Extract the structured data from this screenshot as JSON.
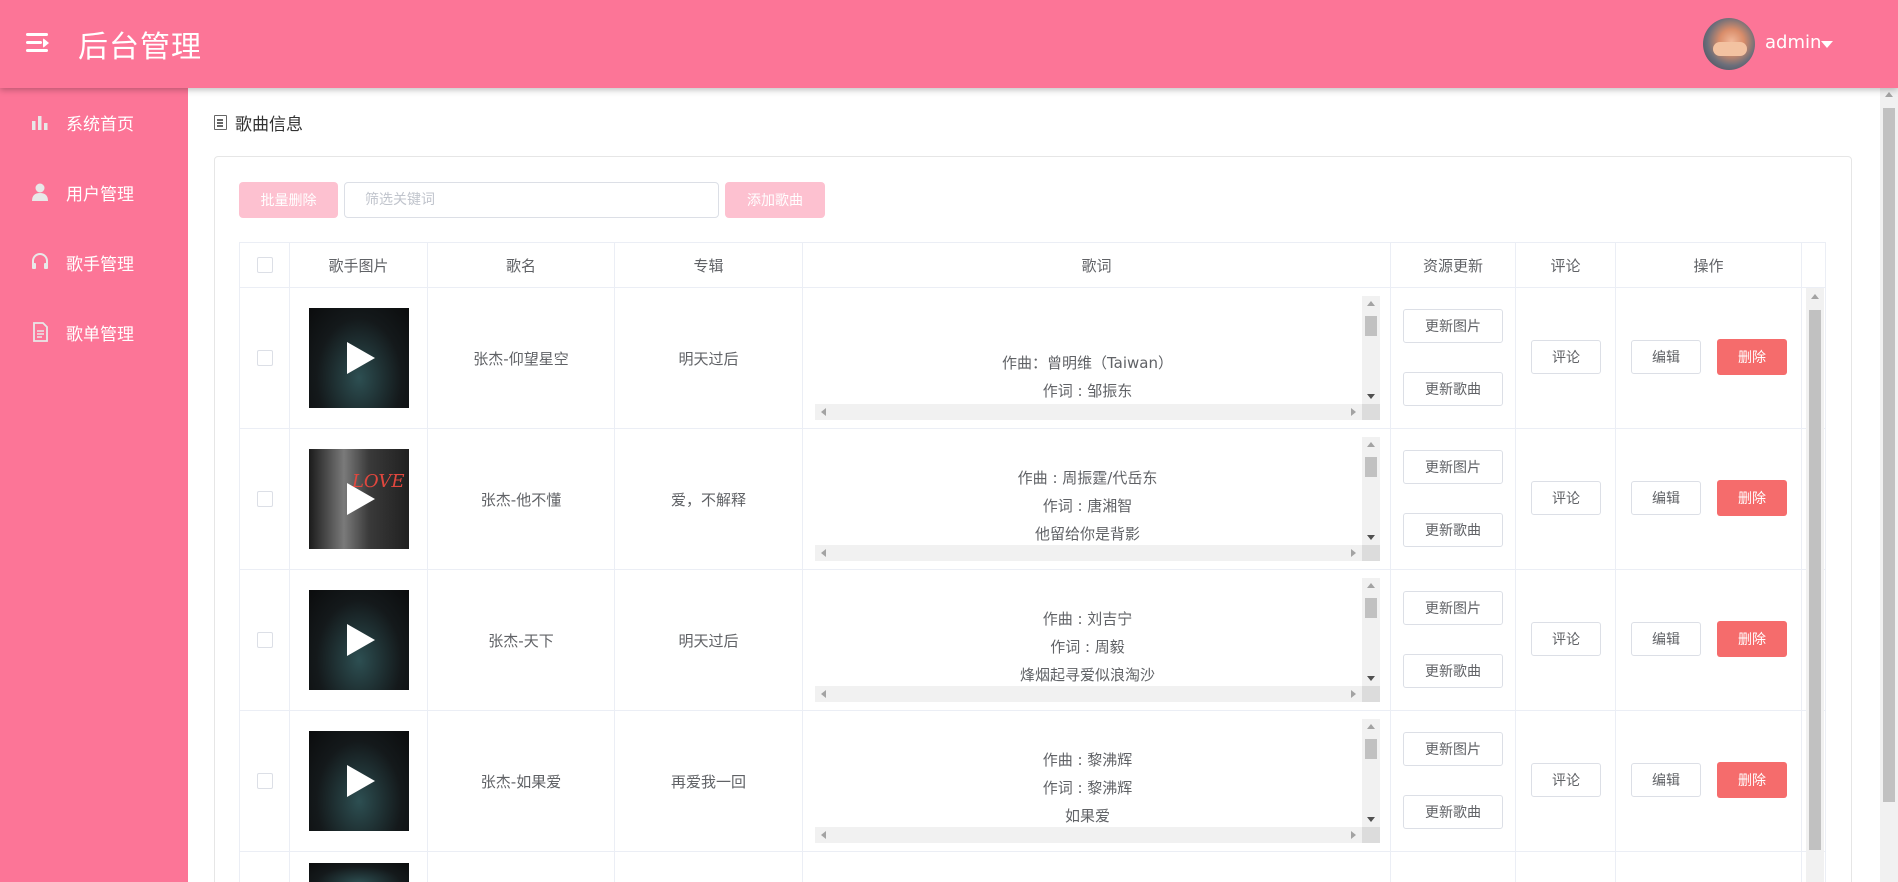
{
  "header": {
    "title": "后台管理",
    "username": "admin"
  },
  "sidebar": {
    "items": [
      {
        "label": "系统首页",
        "icon": "bar-chart-icon"
      },
      {
        "label": "用户管理",
        "icon": "user-icon"
      },
      {
        "label": "歌手管理",
        "icon": "headset-icon"
      },
      {
        "label": "歌单管理",
        "icon": "document-icon"
      }
    ]
  },
  "page": {
    "breadcrumb": "歌曲信息"
  },
  "toolbar": {
    "batch_delete": "批量删除",
    "search_placeholder": "筛选关键词",
    "add_song": "添加歌曲"
  },
  "table": {
    "headers": {
      "image": "歌手图片",
      "name": "歌名",
      "album": "专辑",
      "lyric": "歌词",
      "resource": "资源更新",
      "comment": "评论",
      "action": "操作"
    },
    "buttons": {
      "update_image": "更新图片",
      "update_song": "更新歌曲",
      "comment": "评论",
      "edit": "编辑",
      "delete": "删除"
    },
    "rows": [
      {
        "name": "张杰-仰望星空",
        "album": "明天过后",
        "lyric": [
          "",
          "作曲：曾明维（Taiwan）",
          "作词 : 邹振东"
        ]
      },
      {
        "name": "张杰-他不懂",
        "album": "爱，不解释",
        "lyric": [
          "作曲 : 周振霆/代岳东",
          "作词 : 唐湘智",
          "他留给你是背影"
        ]
      },
      {
        "name": "张杰-天下",
        "album": "明天过后",
        "lyric": [
          "作曲 : 刘吉宁",
          "作词 : 周毅",
          "烽烟起寻爱似浪淘沙"
        ]
      },
      {
        "name": "张杰-如果爱",
        "album": "再爱我一回",
        "lyric": [
          "作曲 : 黎沸辉",
          "作词 : 黎沸辉",
          "如果爱"
        ]
      }
    ]
  },
  "colors": {
    "accent": "#fc7597",
    "danger": "#f56c6c",
    "light_accent": "#fdc1d0"
  }
}
